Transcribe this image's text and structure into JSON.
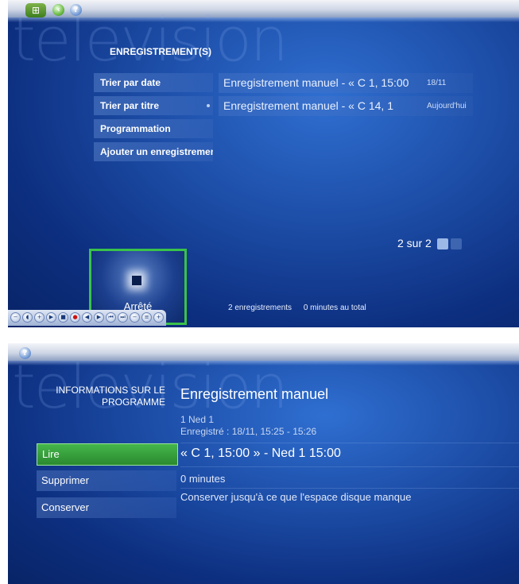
{
  "top_screen": {
    "watermark": "television",
    "section_title": "ENREGISTREMENT(S)",
    "menu": [
      {
        "label": "Trier par date"
      },
      {
        "label": "Trier par titre"
      },
      {
        "label": "Programmation"
      },
      {
        "label": "Ajouter un enregistrement"
      }
    ],
    "recordings": [
      {
        "title": "Enregistrement manuel - « C 1, 15:00",
        "date": "18/11"
      },
      {
        "title": "Enregistrement manuel - « C 14, 1",
        "date": "Aujourd'hui"
      }
    ],
    "pager": "2 sur 2",
    "now_playing_status": "Arrêté",
    "footer": {
      "count": "2 enregistrements",
      "total": "0 minutes au total"
    }
  },
  "bottom_screen": {
    "watermark": "television",
    "section_title_line1": "INFORMATIONS SUR LE",
    "section_title_line2": "PROGRAMME",
    "actions": [
      {
        "label": "Lire"
      },
      {
        "label": "Supprimer"
      },
      {
        "label": "Conserver"
      }
    ],
    "info": {
      "title": "Enregistrement manuel",
      "channel": "1 Ned 1",
      "recorded": "Enregistré : 18/11, 15:25 - 15:26",
      "program": "« C 1, 15:00 » - Ned 1 15:00",
      "duration": "0 minutes",
      "keep": "Conserver jusqu'à ce que l'espace disque manque"
    }
  },
  "colors": {
    "background": "#1d4ea8",
    "focus_green": "#3ac24a",
    "text": "#ffffff"
  },
  "icons": [
    "windows-logo-icon",
    "back-icon",
    "help-icon",
    "stop-icon",
    "arrow-up-icon",
    "arrow-down-icon"
  ]
}
